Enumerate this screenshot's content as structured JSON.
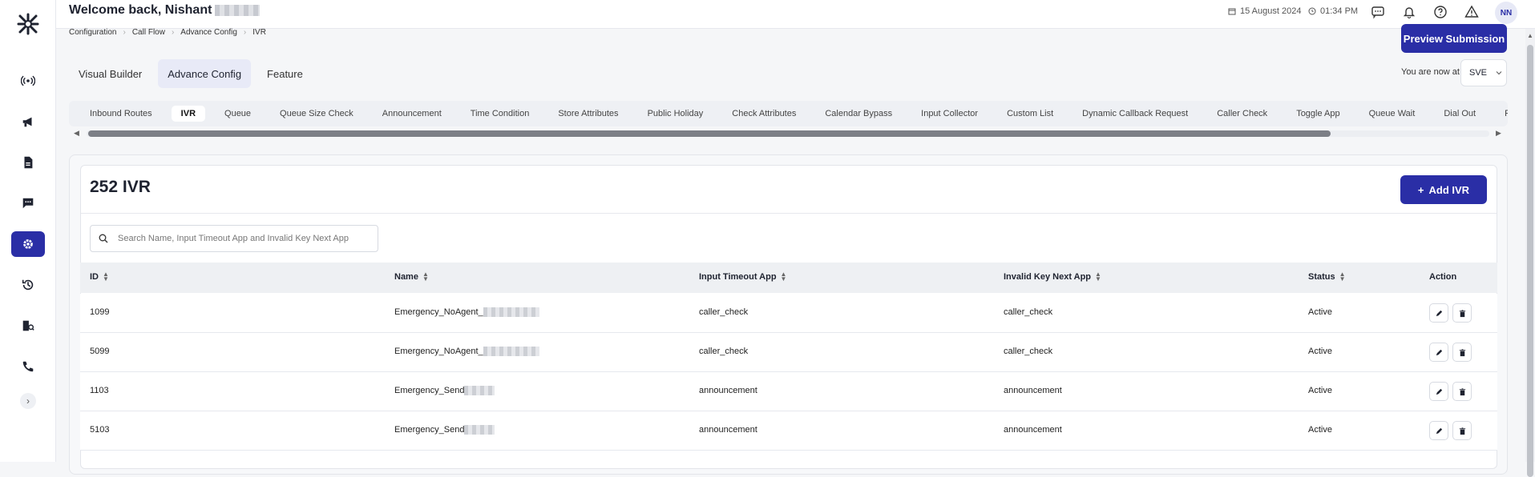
{
  "header": {
    "welcome": "Welcome back, Nishant",
    "date": "15 August 2024",
    "time": "01:34 PM",
    "avatar_initials": "NN"
  },
  "breadcrumb": [
    "Configuration",
    "Call Flow",
    "Advance Config",
    "IVR"
  ],
  "preview_button": "Preview Submission",
  "main_tabs": [
    "Visual Builder",
    "Advance Config",
    "Feature"
  ],
  "location": {
    "label": "You are now at",
    "value": "SVE"
  },
  "sub_tabs": [
    "Inbound Routes",
    "IVR",
    "Queue",
    "Queue Size Check",
    "Announcement",
    "Time Condition",
    "Store Attributes",
    "Public Holiday",
    "Check Attributes",
    "Calendar Bypass",
    "Input Collector",
    "Custom List",
    "Dynamic Callback Request",
    "Caller Check",
    "Toggle App",
    "Queue Wait",
    "Dial Out",
    "Repeated"
  ],
  "card": {
    "title": "252 IVR",
    "add_button": "Add IVR",
    "search_placeholder": "Search Name, Input Timeout App and Invalid Key Next App"
  },
  "table": {
    "columns": [
      "ID",
      "Name",
      "Input Timeout App",
      "Invalid Key Next App",
      "Status",
      "Action"
    ],
    "rows": [
      {
        "id": "1099",
        "name": "Emergency_NoAgent_",
        "timeout": "caller_check",
        "invalid": "caller_check",
        "status": "Active"
      },
      {
        "id": "5099",
        "name": "Emergency_NoAgent_",
        "timeout": "caller_check",
        "invalid": "caller_check",
        "status": "Active"
      },
      {
        "id": "1103",
        "name": "Emergency_Send",
        "timeout": "announcement",
        "invalid": "announcement",
        "status": "Active"
      },
      {
        "id": "5103",
        "name": "Emergency_Send",
        "timeout": "announcement",
        "invalid": "announcement",
        "status": "Active"
      }
    ]
  },
  "colors": {
    "primary": "#2a2ea6",
    "background": "#f5f6f8"
  }
}
